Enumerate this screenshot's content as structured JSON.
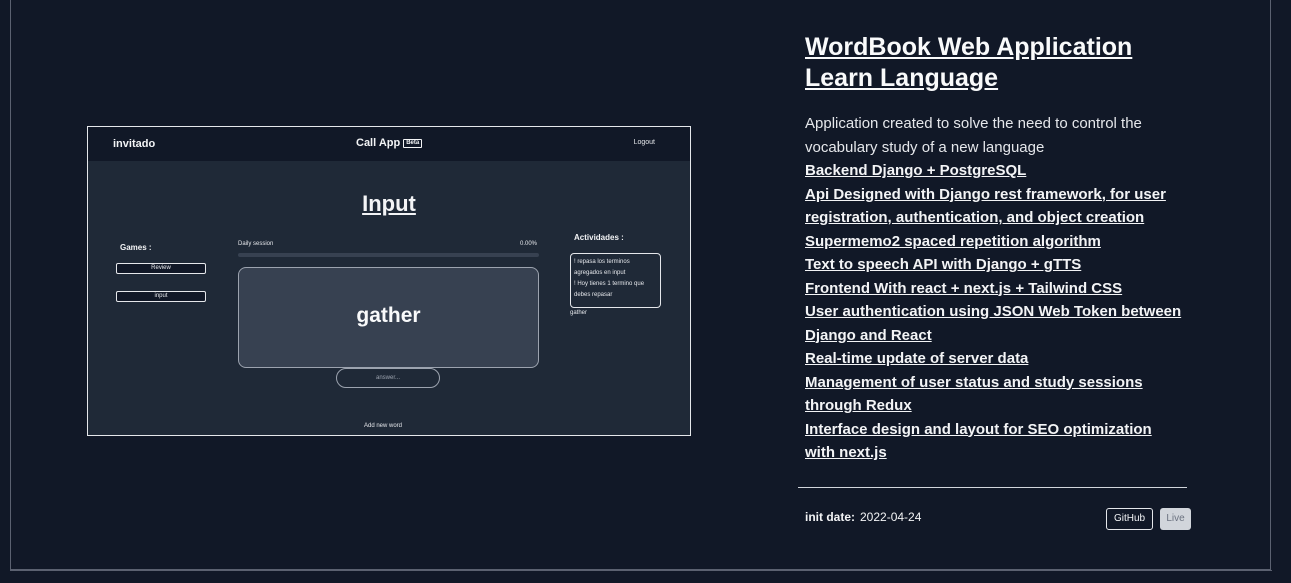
{
  "project": {
    "title": "WordBook Web Application Learn Language",
    "description": "Application created to solve the need to control the vocabulary study of a new language",
    "features": [
      "Backend Django + PostgreSQL",
      "Api Designed with Django rest framework, for user registration, authentication, and object creation",
      "Supermemo2 spaced repetition algorithm",
      "Text to speech API with Django + gTTS",
      "Frontend With react + next.js + Tailwind CSS",
      "User authentication using JSON Web Token between Django and React",
      "Real-time update of server data",
      "Management of user status and study sessions through Redux",
      "Interface design and layout for SEO optimization with next.js"
    ],
    "init_label": "init date:",
    "init_date": "2022-04-24",
    "github_label": "GitHub",
    "live_label": "Live"
  },
  "preview": {
    "user": "invitado",
    "app_name": "Call App",
    "beta": "Beta",
    "logout": "Logout",
    "page_title": "Input",
    "games_label": "Games :",
    "games": [
      "Review",
      "input"
    ],
    "daily_session": "Daily session",
    "daily_progress": "0.00%",
    "word": "gather",
    "answer_placeholder": "answer...",
    "activities_label": "Actividades :",
    "activities": [
      "! repasa los terminos agregados en input",
      "! Hoy tienes 1 termino que debes repasar"
    ],
    "activity_word": "gather",
    "add_new_word": "Add new word"
  }
}
